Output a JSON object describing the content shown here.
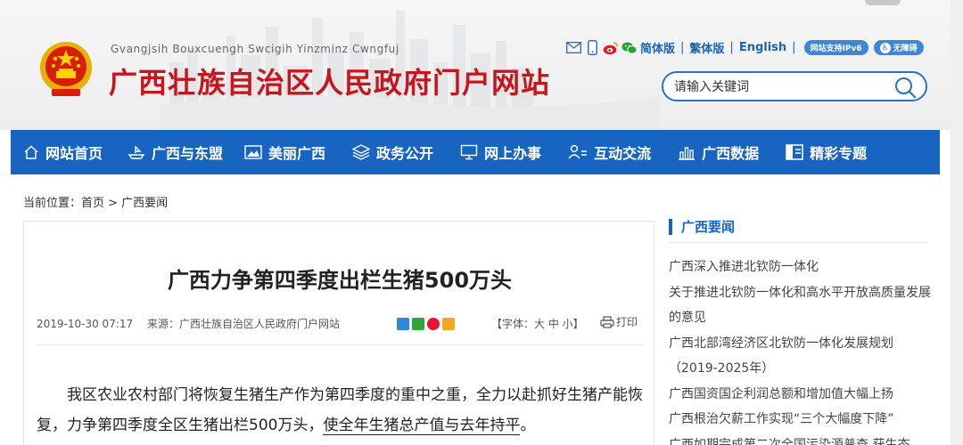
{
  "header": {
    "english_name": "Gvangjsih Bouxcuengh Swcigih Yinzminz Cwngfuj",
    "chinese_name": "广西壮族自治区人民政府门户网站",
    "links": [
      {
        "label": "简体版"
      },
      {
        "label": "繁体版"
      },
      {
        "label": "English"
      }
    ],
    "ipv6_label": "网站支持IPv6",
    "accessibility_label": "无障碍",
    "search_placeholder": "请输入关键词"
  },
  "nav": {
    "items": [
      {
        "label": "网站首页",
        "icon": "home-icon"
      },
      {
        "label": "广西与东盟",
        "icon": "ship-icon"
      },
      {
        "label": "美丽广西",
        "icon": "photo-icon"
      },
      {
        "label": "政务公开",
        "icon": "layers-icon"
      },
      {
        "label": "网上办事",
        "icon": "monitor-icon"
      },
      {
        "label": "互动交流",
        "icon": "people-icon"
      },
      {
        "label": "广西数据",
        "icon": "chart-icon"
      },
      {
        "label": "精彩专题",
        "icon": "board-icon"
      }
    ]
  },
  "breadcrumb": "当前位置：首页 > 广西要闻",
  "article": {
    "title": "广西力争第四季度出栏生猪500万头",
    "datetime": "2019-10-30 07:17",
    "source": "来源：广西壮族自治区人民政府门户网站",
    "font_size": "【字体：大 中 小】",
    "print": "打印",
    "body_a": "我区农业农村部门将恢复生猪生产作为第四季度的重中之重，全力以赴抓好生猪产能恢复，力争第四季度全区生猪出栏500万头，",
    "body_b": "使全年生猪总产值与去年持平",
    "body_c": "。"
  },
  "sidebar": {
    "heading": "广西要闻",
    "items": [
      {
        "label": "广西深入推进北钦防一体化"
      },
      {
        "label": "关于推进北钦防一体化和高水平开放高质量发展的意见"
      },
      {
        "label": "广西北部湾经济区北钦防一体化发展规划（2019-2025年）"
      },
      {
        "label": "广西国资国企利润总额和增加值大幅上扬"
      },
      {
        "label": "广西根治欠薪工作实现“三个大幅度下降”"
      },
      {
        "label": "广西如期完成第二次全国污染源普查 获生态"
      }
    ]
  },
  "colors": {
    "brand_red": "#c6151d",
    "nav_blue": "#1765c1",
    "link_blue": "#1a62b5"
  }
}
